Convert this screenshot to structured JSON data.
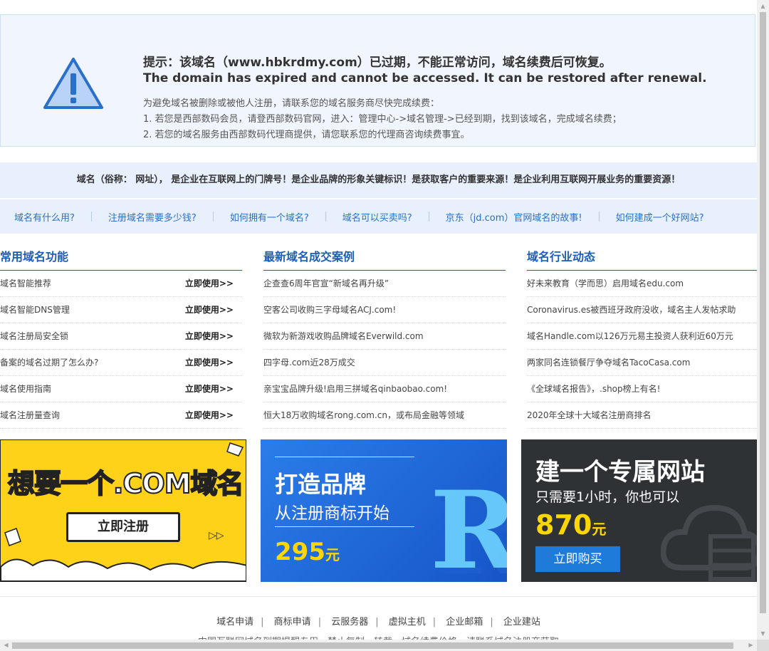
{
  "notice": {
    "title_cn": "提示：该域名（www.hbkrdmy.com）已过期，不能正常访问，域名续费后可恢复。",
    "title_en": "The domain has expired and cannot be accessed. It can be restored after renewal.",
    "p1": "为避免域名被删除或被他人注册，请联系您的域名服务商尽快完成续费：",
    "p2": "1. 若您是西部数码会员，请登西部数码官网，进入：管理中心->域名管理->已经到期，找到该域名，完成域名续费；",
    "p3": "2. 若您的域名服务由西部数码代理商提供，请您联系您的代理商咨询续费事宜。"
  },
  "slogan": "域名（俗称： 网址），  是企业在互联网上的门牌号！是企业品牌的形象关键标识！是获取客户的重要来源！是企业利用互联网开展业务的重要资源！",
  "faq": [
    "域名有什么用?",
    "注册域名需要多少钱?",
    "如何拥有一个域名?",
    "域名可以买卖吗?",
    "京东（jd.com）官网域名的故事!",
    "如何建成一个好网站?"
  ],
  "columns": {
    "features": {
      "title": "常用域名功能",
      "use_label": "立即使用>>",
      "items": [
        "域名智能推荐",
        "域名智能DNS管理",
        "域名注册局安全锁",
        "备案的域名过期了怎么办?",
        "域名使用指南",
        "域名注册量查询"
      ]
    },
    "cases": {
      "title": "最新域名成交案例",
      "items": [
        "企查查6周年官宣“新域名再升级”",
        "空客公司收购三字母域名ACJ.com!",
        "微软为新游戏收购品牌域名Everwild.com",
        "四字母.com近28万成交",
        "亲宝宝品牌升级!启用三拼域名qinbaobao.com!",
        "恒大18万收购域名rong.com.cn，或布局金融等领域"
      ]
    },
    "news": {
      "title": "域名行业动态",
      "items": [
        "好未来教育（学而思）启用域名edu.com",
        "Coronavirus.es被西班牙政府没收，域名主人发帖求助",
        "域名Handle.com以126万元易主投资人获利近60万元",
        "两家同名连锁餐厅争夺域名TacoCasa.com",
        "《全球域名报告》，.shop榜上有名!",
        "2020年全球十大域名注册商排名"
      ]
    }
  },
  "banners": {
    "b1": {
      "title": "想要一个.COM域名",
      "button": "立即注册",
      "play": "▷▷"
    },
    "b2": {
      "h1": "打造品牌",
      "h2": "从注册商标开始",
      "price": "295",
      "unit": "元",
      "glyph": "R"
    },
    "b3": {
      "h1": "建一个专属网站",
      "h2": "只需要1小时，你也可以",
      "price": "870",
      "unit": "元",
      "button": "立即购买"
    }
  },
  "footer": {
    "links": [
      "域名申请",
      "商标申请",
      "云服务器",
      "虚拟主机",
      "企业邮箱",
      "企业建站"
    ],
    "note": "中国互联网域名到期提醒专用，禁止复制，转载，域名续费价格，请联系域名注册商获取"
  },
  "colors": {
    "accent": "#1d5fb4",
    "link": "#2a6fc9",
    "notice_bg": "#f1f6fe",
    "band_bg": "#e8f0fd",
    "yellow": "#ffd21a",
    "gold": "#ffd700"
  },
  "icons": {
    "warning": "warning-triangle-icon"
  }
}
